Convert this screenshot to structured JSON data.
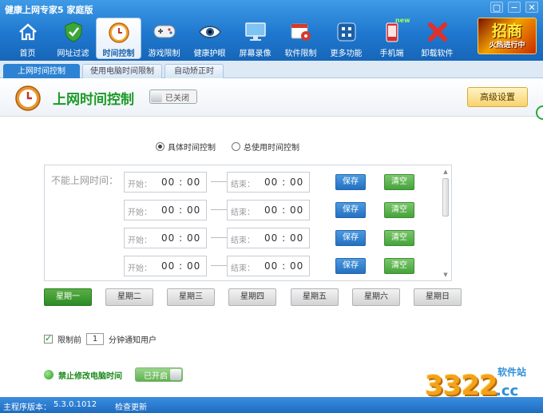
{
  "window": {
    "title": "健康上网专家5 家庭版",
    "min": "▢",
    "max": "−",
    "close": "✕"
  },
  "toolbar": [
    {
      "name": "home",
      "label": "首页",
      "icon": "home-icon"
    },
    {
      "name": "url-filter",
      "label": "网址过滤",
      "icon": "shield-icon"
    },
    {
      "name": "time-control",
      "label": "时间控制",
      "icon": "clock-icon",
      "active": true
    },
    {
      "name": "game-limit",
      "label": "游戏限制",
      "icon": "gamepad-icon"
    },
    {
      "name": "eye-care",
      "label": "健康护眼",
      "icon": "eye-icon"
    },
    {
      "name": "screen-record",
      "label": "屏幕录像",
      "icon": "monitor-icon"
    },
    {
      "name": "software-limit",
      "label": "软件限制",
      "icon": "disc-icon"
    },
    {
      "name": "more",
      "label": "更多功能",
      "icon": "grid-icon"
    },
    {
      "name": "mobile",
      "label": "手机端",
      "icon": "phone-icon",
      "badge": "new"
    },
    {
      "name": "uninstall",
      "label": "卸载软件",
      "icon": "x-icon"
    }
  ],
  "promo": {
    "big": "招商",
    "small": "火热进行中"
  },
  "tabs": [
    "上网时间控制",
    "使用电脑时间限制",
    "自动矫正时间"
  ],
  "section": {
    "title": "上网时间控制",
    "toggle": "已关闭",
    "advanced": "高级设置"
  },
  "modes": {
    "specific": "具体时间控制",
    "total": "总使用时间控制"
  },
  "timelist": {
    "label": "不能上网时间：",
    "start_label": "开始：",
    "end_label": "结束：",
    "save": "保存",
    "clear": "清空",
    "rows": [
      {
        "start": "00 : 00",
        "end": "00 : 00"
      },
      {
        "start": "00 : 00",
        "end": "00 : 00"
      },
      {
        "start": "00 : 00",
        "end": "00 : 00"
      },
      {
        "start": "00 : 00",
        "end": "00 : 00"
      }
    ]
  },
  "days": [
    "星期一",
    "星期二",
    "星期三",
    "星期四",
    "星期五",
    "星期六",
    "星期日"
  ],
  "notify": {
    "before": "限制前",
    "minutes": "1",
    "after": "分钟通知用户"
  },
  "lock": {
    "label": "禁止修改电脑时间",
    "toggle": "已开启"
  },
  "watermark": {
    "num": "3322",
    "tag": "软件站",
    "domain": ".cc"
  },
  "status": {
    "version_label": "主程序版本：",
    "version": "5.3.0.1012",
    "update": "检查更新"
  }
}
